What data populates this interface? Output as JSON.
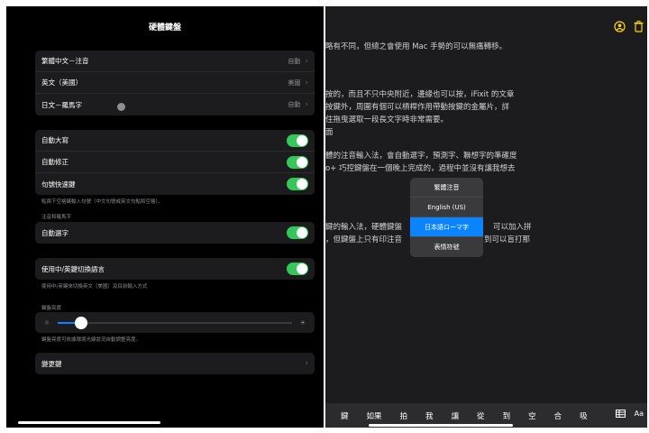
{
  "settings": {
    "title": "硬體鍵盤",
    "languages": [
      {
        "label": "繁體中文－注音",
        "value": "自動"
      },
      {
        "label": "英文（美國）",
        "value": "美國"
      },
      {
        "label": "日文－羅馬字",
        "value": "自動"
      }
    ],
    "toggles": [
      {
        "label": "自動大寫",
        "on": true
      },
      {
        "label": "自動修正",
        "on": true
      },
      {
        "label": "句號快速鍵",
        "on": true
      }
    ],
    "period_note": "點兩下空格鍵輸入句號（中文句號或英文句點和空格）。",
    "section_zhuyin": "注音和羅馬字",
    "auto_select": {
      "label": "自動選字",
      "on": true
    },
    "caps_switch": {
      "label": "使用中/英鍵切換語言",
      "on": true
    },
    "caps_note": "使用中/英鍵來切換英文（美國）及目前輸入方式",
    "brightness_header": "鍵盤亮度",
    "brightness_level": 0.1,
    "brightness_note": "鍵盤亮度可依據環境光線狀況自動調整亮度。",
    "modifier_keys": "變更鍵"
  },
  "doc": {
    "lines": [
      "略有不同，但總之會使用 Mac 手勢的可以無痛轉移。",
      "按的，而且不只中央附近，邊緣也可以按，iFixit 的文章",
      "按鍵外，周圍有個可以槓桿作用帶動按鍵的金屬片，詳",
      "住拖曳選取一段長文字時非常需要。",
      "面",
      "體的注音輸入法，會自動選字，預測字、聯想字的準確度",
      "o+ 巧控鍵盤在一個晚上完成的，過程中並沒有讓我想去",
      "鍵的輸入法，硬體鍵盤",
      "可以加入拼",
      "，但鍵盤上只有印注音",
      "到可以盲打那"
    ]
  },
  "language_menu": {
    "items": [
      "繁體注音",
      "English (US)",
      "日本語ローマ字",
      "表情符號"
    ],
    "selected_index": 2
  },
  "candidates": [
    "鍵",
    "如果",
    "拍",
    "我",
    "讓",
    "從",
    "到",
    "空",
    "合",
    "吸"
  ],
  "kb_right_label": "Aa",
  "icons": {
    "people": "person-badge-icon",
    "trash": "trash-icon",
    "table": "table-icon",
    "brightness_low": "sun-small-icon",
    "brightness_high": "sun-large-icon"
  },
  "colors": {
    "toggle_on": "#34c759",
    "accent": "#0a84ff",
    "icon_yellow": "#ffd60a"
  }
}
